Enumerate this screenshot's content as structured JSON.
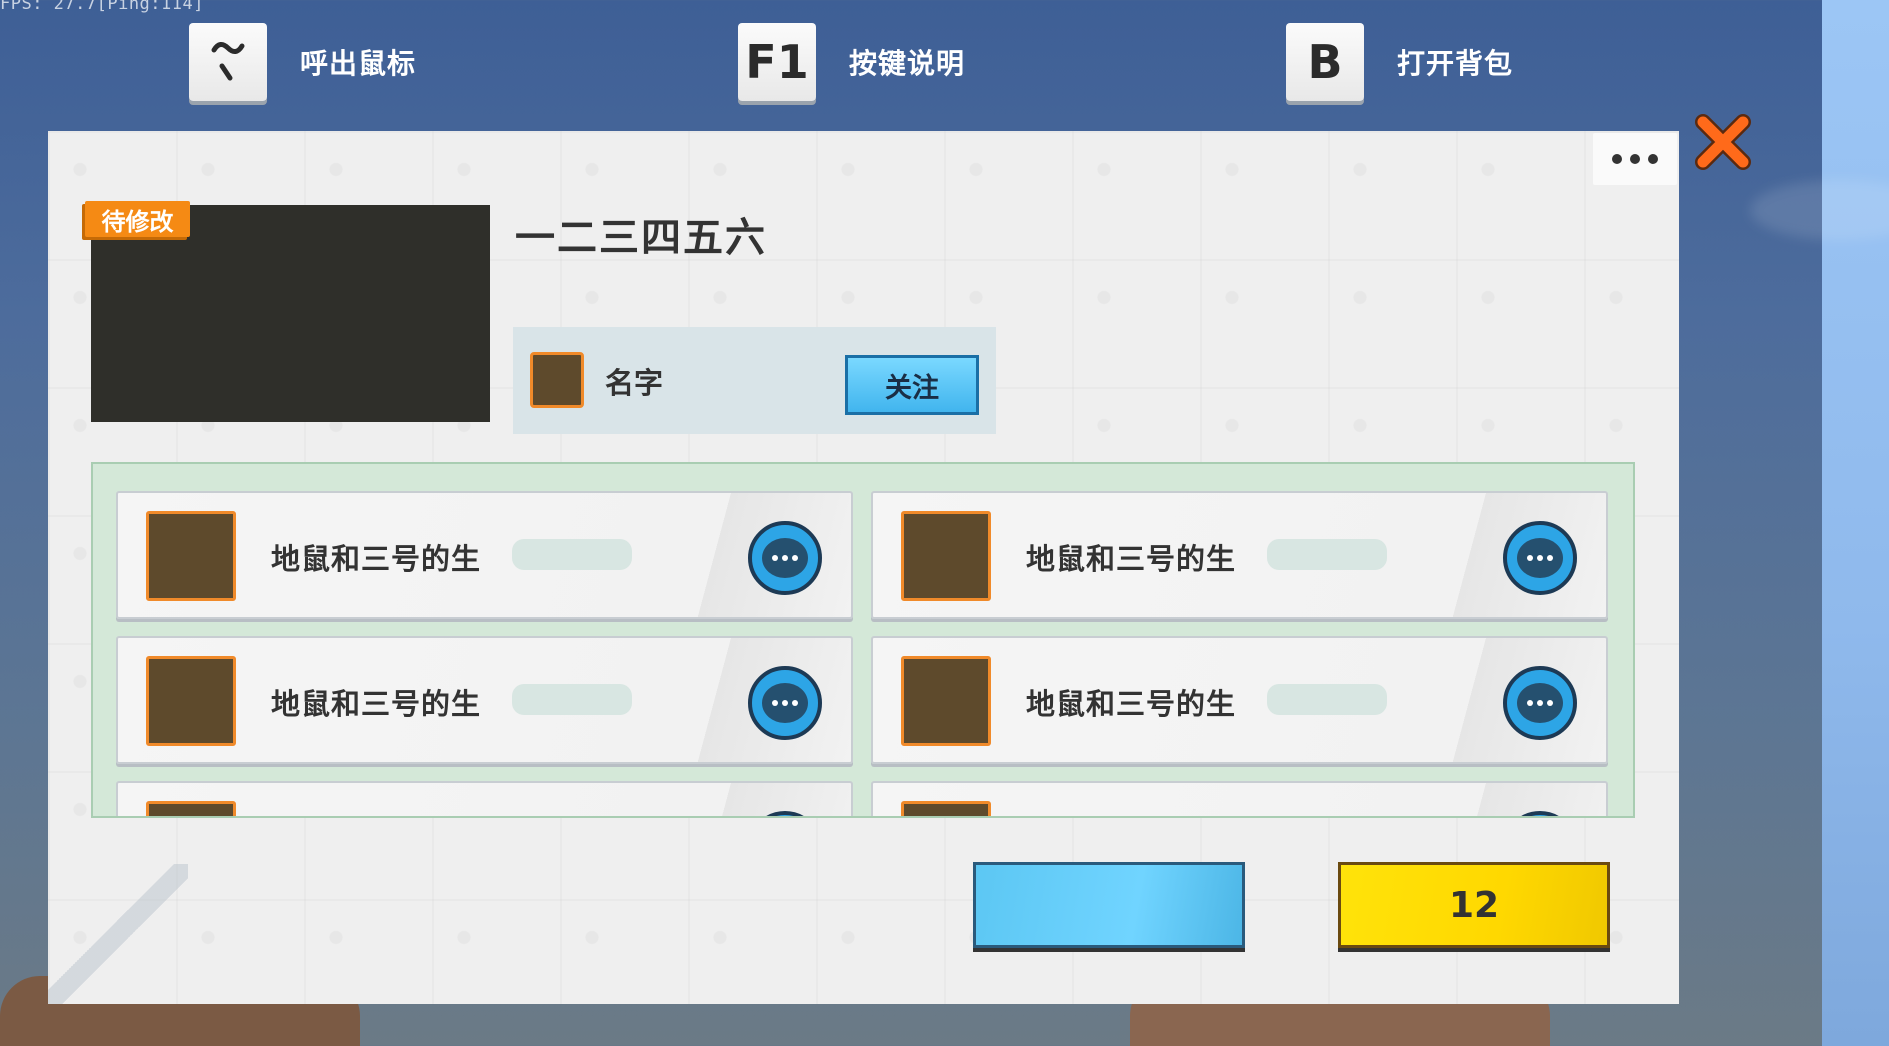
{
  "hud": {
    "fps_text": "FPS: 27.7[Ping:114]",
    "hints": [
      {
        "key": "~",
        "label": "呼出鼠标"
      },
      {
        "key": "F1",
        "label": "按键说明"
      },
      {
        "key": "B",
        "label": "打开背包"
      }
    ]
  },
  "panel": {
    "tag": "待修改",
    "title": "一二三四五六",
    "author": {
      "name": "名字",
      "follow_label": "关注"
    },
    "players": [
      {
        "name": "地鼠和三号的生"
      },
      {
        "name": "地鼠和三号的生"
      },
      {
        "name": "地鼠和三号的生"
      },
      {
        "name": "地鼠和三号的生"
      },
      {
        "name": ""
      },
      {
        "name": ""
      }
    ],
    "primary_button_label": "",
    "count_button_label": "12"
  },
  "colors": {
    "accent_orange": "#f58a14",
    "button_blue": "#5cc7f3",
    "button_yellow": "#ffd800",
    "list_green": "#d4e8d8"
  },
  "icons": [
    "tilde-key-icon",
    "more-options-icon",
    "close-icon",
    "chat-icon"
  ]
}
